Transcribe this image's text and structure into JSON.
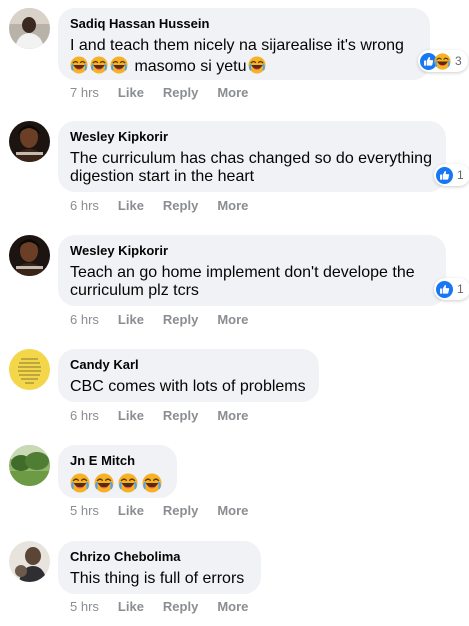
{
  "colors": {
    "bubble": "#f0f2f5",
    "like_blue": "#1877f2",
    "meta_text": "#8a8d91"
  },
  "actions": {
    "like": "Like",
    "reply": "Reply",
    "more": "More"
  },
  "comments": [
    {
      "author": "Sadiq Hassan Hussein",
      "line1": "I and teach them nicely na sijarealise it's wrong",
      "line2": "masomo si yetu",
      "time": "7 hrs",
      "reaction_icons": [
        "like-icon",
        "laugh-icon"
      ],
      "reaction_count": "3"
    },
    {
      "author": "Wesley Kipkorir",
      "line1": "The curriculum has chas changed so do everything",
      "line2": "digestion start in the heart",
      "time": "6 hrs",
      "reaction_icons": [
        "like-icon"
      ],
      "reaction_count": "1"
    },
    {
      "author": "Wesley Kipkorir",
      "line1": "Teach an go home implement don't develope the",
      "line2": "curriculum plz tcrs",
      "time": "6 hrs",
      "reaction_icons": [
        "like-icon"
      ],
      "reaction_count": "1"
    },
    {
      "author": "Candy Karl",
      "line1": "CBC comes with lots of problems",
      "time": "6 hrs"
    },
    {
      "author": "Jn E Mitch",
      "emoji_icons": [
        "laugh-icon",
        "laugh-icon",
        "laugh-icon",
        "laugh-icon"
      ],
      "time": "5 hrs"
    },
    {
      "author": "Chrizo Chebolima",
      "line1": "This thing is full of errors",
      "time": "5 hrs"
    }
  ]
}
